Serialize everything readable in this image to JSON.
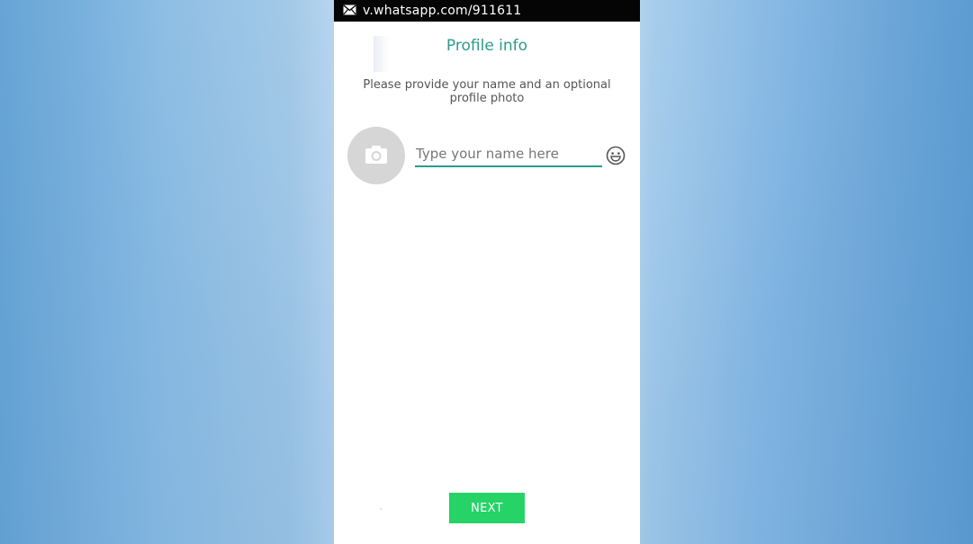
{
  "status_bar": {
    "notification_icon": "mail-icon",
    "url_text": "v.whatsapp.com/911611"
  },
  "profile": {
    "title": "Profile info",
    "subtitle": "Please provide your name and an optional profile photo",
    "photo_icon": "camera-icon",
    "name_input": {
      "value": "",
      "placeholder": "Type your name here"
    },
    "emoji_icon": "smiley-icon",
    "next_label": "NEXT"
  },
  "colors": {
    "accent": "#2c9b8c",
    "next_button": "#25d366",
    "status_bar": "#050505",
    "photo_circle": "#d6d6d6"
  }
}
